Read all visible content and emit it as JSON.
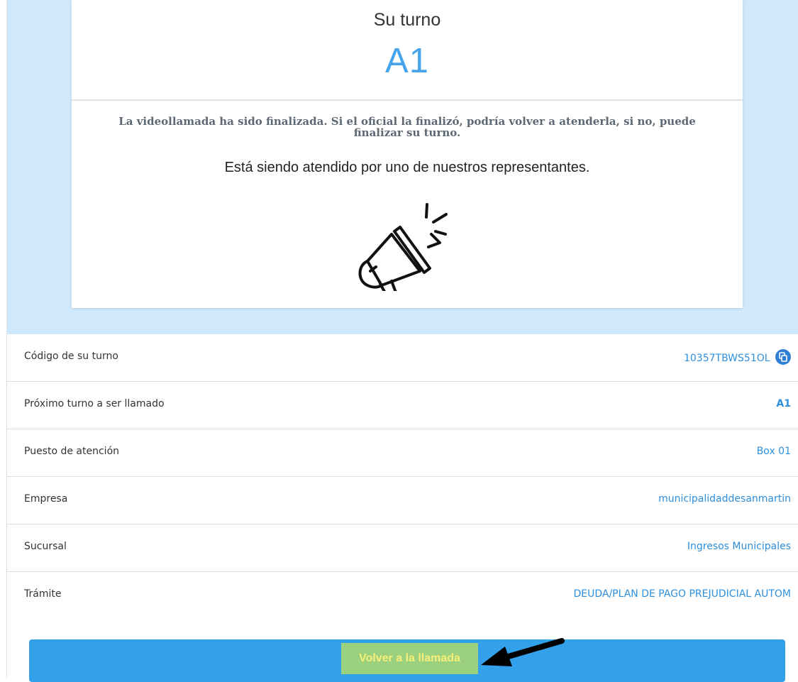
{
  "header": {
    "turn_label": "Su turno",
    "turn_code": "A1"
  },
  "notice": {
    "text": "La videollamada ha sido finalizada. Si el oficial la finalizó, podría volver a atenderla, si no, puede finalizar su turno.",
    "status": "Está siendo atendido por uno de nuestros representantes.",
    "icon": "megaphone-icon"
  },
  "details": [
    {
      "label": "Código de su turno",
      "value": "10357TBWS51OL",
      "icon": "copy-icon"
    },
    {
      "label": "Próximo turno a ser llamado",
      "value": "A1"
    },
    {
      "label": "Puesto de atención",
      "value": "Box 01"
    },
    {
      "label": "Empresa",
      "value": "municipalidaddesanmartin"
    },
    {
      "label": "Sucursal",
      "value": "Ingresos Municipales"
    },
    {
      "label": "Trámite",
      "value": "DEUDA/PLAN DE PAGO PREJUDICIAL AUTOM"
    }
  ],
  "actions": {
    "return_to_call": "Volver a la llamada"
  },
  "colors": {
    "accent": "#46a4ec",
    "hero_background": "#d0e8fc",
    "value_text": "#2e8fdd",
    "bottom_bar": "#33a0ea",
    "button_highlight": "#9bd07e",
    "button_text": "#f6f07a"
  }
}
